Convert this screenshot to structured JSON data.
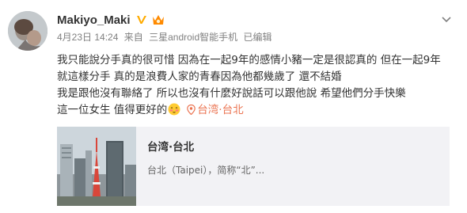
{
  "post": {
    "username": "Makiyo_Maki",
    "verified_icon": "verified-v-badge",
    "member_icon": "member-crown-icon",
    "more_icon": "chevron-down-icon",
    "date": "4月23日 14:24",
    "source_prefix": "来自",
    "source": "三星android智能手机",
    "edited": "已编辑",
    "content_lines": [
      "我只能說分手真的很可惜 因為在一起9年的感情小豬一定是很認真的 但在一起9年",
      "就這樣分手 真的是浪費人家的青春因為他都幾歲了 還不結婚",
      "我是跟他沒有聯絡了 所以也沒有什麼好說話可以跟他說 希望他們分手快樂",
      "這一位女生 值得更好的"
    ],
    "emoji_icon": "blushing-face-emoji",
    "location_label": "台湾·台北"
  },
  "card": {
    "title": "台湾·台北",
    "description": "台北（Taipei），简称“北”..."
  },
  "colors": {
    "accent": "#eb7350",
    "badge": "#ffab00",
    "card_bg": "#f2f2f5",
    "meta": "#808080"
  }
}
